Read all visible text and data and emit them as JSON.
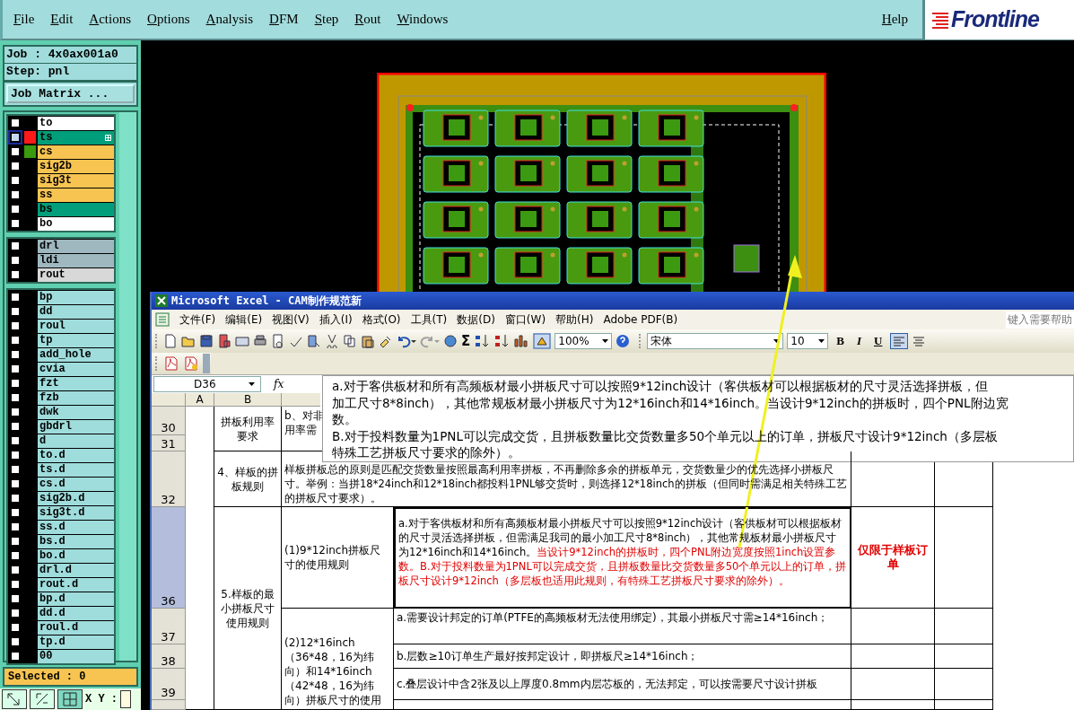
{
  "menubar": {
    "items": [
      "File",
      "Edit",
      "Actions",
      "Options",
      "Analysis",
      "DFM",
      "Step",
      "Rout",
      "Windows"
    ],
    "help": "Help",
    "logo": "Frontline"
  },
  "job_panel": {
    "job": "Job : 4x0ax001a0",
    "step": "Step: pnl",
    "matrix_button": "Job Matrix ..."
  },
  "layer_groups": [
    {
      "layers": [
        {
          "name": "to",
          "color": "#ffffff",
          "active": false
        },
        {
          "name": "ts",
          "color": "#009e7a",
          "active": true,
          "swatch": {
            "color": "#ff1a1a"
          }
        },
        {
          "name": "cs",
          "color": "#f7c452",
          "active": false,
          "swatch": {
            "color": "#3a9a10"
          }
        },
        {
          "name": "sig2b",
          "color": "#f7c452",
          "active": false
        },
        {
          "name": "sig3t",
          "color": "#f7c452",
          "active": false
        },
        {
          "name": "ss",
          "color": "#f7c452",
          "active": false
        },
        {
          "name": "bs",
          "color": "#009e7a",
          "active": false
        },
        {
          "name": "bo",
          "color": "#ffffff",
          "active": false
        }
      ]
    },
    {
      "layers": [
        {
          "name": "drl",
          "color": "#9fb8c0",
          "active": false
        },
        {
          "name": "ldi",
          "color": "#9fb8c0",
          "active": false
        },
        {
          "name": "rout",
          "color": "#d8d8d8",
          "active": false
        }
      ]
    },
    {
      "layers": [
        {
          "name": "bp",
          "color": "#9fdcdc",
          "active": false
        },
        {
          "name": "dd",
          "color": "#9fdcdc",
          "active": false
        },
        {
          "name": "roul",
          "color": "#9fdcdc",
          "active": false
        },
        {
          "name": "tp",
          "color": "#9fdcdc",
          "active": false
        },
        {
          "name": "add_hole",
          "color": "#9fdcdc",
          "active": false
        },
        {
          "name": "cvia",
          "color": "#9fdcdc",
          "active": false
        },
        {
          "name": "fzt",
          "color": "#9fdcdc",
          "active": false
        },
        {
          "name": "fzb",
          "color": "#9fdcdc",
          "active": false
        },
        {
          "name": "dwk",
          "color": "#9fdcdc",
          "active": false
        },
        {
          "name": "gbdrl",
          "color": "#9fdcdc",
          "active": false
        },
        {
          "name": "d",
          "color": "#9fdcdc",
          "active": false
        },
        {
          "name": "to.d",
          "color": "#9fdcdc",
          "active": false
        },
        {
          "name": "ts.d",
          "color": "#9fdcdc",
          "active": false
        },
        {
          "name": "cs.d",
          "color": "#9fdcdc",
          "active": false
        },
        {
          "name": "sig2b.d",
          "color": "#9fdcdc",
          "active": false
        },
        {
          "name": "sig3t.d",
          "color": "#9fdcdc",
          "active": false
        },
        {
          "name": "ss.d",
          "color": "#9fdcdc",
          "active": false
        },
        {
          "name": "bs.d",
          "color": "#9fdcdc",
          "active": false
        },
        {
          "name": "bo.d",
          "color": "#9fdcdc",
          "active": false
        },
        {
          "name": "drl.d",
          "color": "#9fdcdc",
          "active": false
        },
        {
          "name": "rout.d",
          "color": "#9fdcdc",
          "active": false
        },
        {
          "name": "bp.d",
          "color": "#9fdcdc",
          "active": false
        },
        {
          "name": "dd.d",
          "color": "#9fdcdc",
          "active": false
        },
        {
          "name": "roul.d",
          "color": "#9fdcdc",
          "active": false
        },
        {
          "name": "tp.d",
          "color": "#9fdcdc",
          "active": false
        },
        {
          "name": "00",
          "color": "#9fdcdc",
          "active": false
        }
      ]
    }
  ],
  "selected_count": "Selected : 0",
  "coords_label": "X Y :",
  "excel": {
    "title": "Microsoft Excel - CAM制作规范新",
    "menu": [
      "文件(F)",
      "编辑(E)",
      "视图(V)",
      "插入(I)",
      "格式(O)",
      "工具(T)",
      "数据(D)",
      "窗口(W)",
      "帮助(H)",
      "Adobe PDF(B)"
    ],
    "help_placeholder": "键入需要帮助",
    "sum": "Σ",
    "zoom": "100%",
    "font": "宋体",
    "font_size": "10",
    "format_buttons": [
      "B",
      "I",
      "U"
    ],
    "name_box": "D36",
    "fx": "fx",
    "columns": [
      "A",
      "B"
    ],
    "rows": [
      {
        "number": "30",
        "selected": false
      },
      {
        "number": "31",
        "selected": false
      },
      {
        "number": "32",
        "selected": false
      },
      {
        "number": "36",
        "selected": true
      },
      {
        "number": "37",
        "selected": false
      },
      {
        "number": "38",
        "selected": false
      },
      {
        "number": "39",
        "selected": false
      }
    ],
    "cells": {
      "b30": "拼板利用率要求",
      "c30": "b、对非用率需",
      "b32": "4、样板的拼板规则",
      "c32": "样板拼板总的原则是匹配交货数量按照最高利用率拼板，不再删除多余的拼板单元，交货数量少的优先选择小拼板尺寸。举例：当拼18*24inch和12*18inch都投料1PNL够交货时，则选择12*18inch的拼板（但同时需满足相关特殊工艺的拼板尺寸要求）。",
      "b36": "5.样板的最小拼板尺寸使用规则",
      "c36": "(1)9*12inch拼板尺寸的使用规则",
      "d36": [
        {
          "text": "a.对于客供板材和所有高频板材最小拼板尺寸可以按照9*12inch设计（客供板材可以根据板材的尺寸灵活选择拼板，但需满足我司的最小加工尺寸8*8inch），其他常规板材最小拼板尺寸为12*16inch和14*16inch。",
          "red": false
        },
        {
          "text": "当设计9*12inch的拼板时，四个PNL附边宽度按照1inch设置参数。",
          "red": true
        },
        {
          "text": "B.对于投料数量为1PNL可以完成交货，且拼板数量比交货数量多50个单元以上的订单，拼板尺寸设计9*12inch（多层板也适用此规则，有特殊工艺拼板尺寸要求的除外）。",
          "red": true
        }
      ],
      "e36": "仅限于样板订单",
      "c37": "(2)12*16inch（36*48，16为纬向）和14*16inch（42*48，16为纬向）拼板尺寸的使用",
      "d37": "a.需要设计邦定的订单(PTFE的高频板材无法使用绑定)，其最小拼板尺寸需≥14*16inch；",
      "d38": "b.层数≥10订单生产最好按邦定设计，即拼板尺≥14*16inch；",
      "d39": "c.叠层设计中含2张及以上厚度0.8mm内层芯板的，无法邦定，可以按需要尺寸设计拼板"
    },
    "comment": [
      "a.对于客供板材和所有高频板材最小拼板尺寸可以按照9*12inch设计（客供板材可以根据板材的尺寸灵活选择拼板，但",
      "加工尺寸8*8inch），其他常规板材最小拼板尺寸为12*16inch和14*16inch。当设计9*12inch的拼板时，四个PNL附边宽",
      "数。",
      "B.对于投料数量为1PNL可以完成交货，且拼板数量比交货数量多50个单元以上的订单，拼板尺寸设计9*12inch（多层板",
      "特殊工艺拼板尺寸要求的除外）。"
    ]
  }
}
